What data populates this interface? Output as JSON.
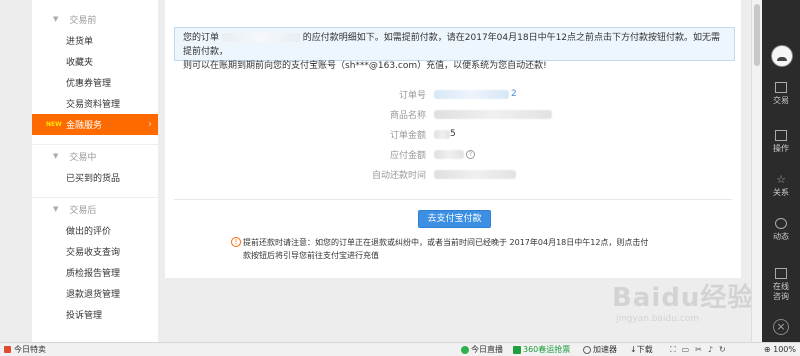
{
  "sidebar": {
    "sections": [
      {
        "title": "交易前",
        "items": [
          "进货单",
          "收藏夹",
          "优惠券管理",
          "交易资料管理"
        ],
        "active_item": "金融服务",
        "active_badge": "NEW"
      },
      {
        "title": "交易中",
        "items": [
          "已买到的货品"
        ]
      },
      {
        "title": "交易后",
        "items": [
          "做出的评价",
          "交易收支查询",
          "质检报告管理",
          "退款退货管理",
          "投诉管理"
        ]
      }
    ]
  },
  "notice": {
    "prefix": "您的订单",
    "suffix_line1": "的应付款明细如下。如需提前付款，请在2017年04月18日中午12点之前点击下方付款按钮付款。如无需提前付款，",
    "line2": "则可以在账期到期前向您的支付宝账号（sh***@163.com）充值，以便系统为您自动还款!"
  },
  "info": {
    "order_no_label": "订单号",
    "order_no_tail": "2",
    "product_label": "商品名称",
    "order_amount_label": "订单金额",
    "order_amount_partial": "5",
    "payable_label": "应付金额",
    "payable_help": "?",
    "auto_repay_label": "自动还款时间"
  },
  "pay_button": "去支付宝付款",
  "warning": {
    "icon": "!",
    "line1": "提前还款时请注意：如您的订单正在退款或纠纷中，或者当前时间已经晚于 2017年04月18日中午12点，则点击付",
    "line2": "款按钮后将引导您前往支付宝进行充值"
  },
  "right_toolbar": {
    "tools": [
      {
        "label": "交易",
        "icon": "cart-icon"
      },
      {
        "label": "操作",
        "icon": "grid-icon"
      },
      {
        "label": "关系",
        "icon": "star-icon"
      },
      {
        "label": "动态",
        "icon": "clock-icon"
      },
      {
        "label_line1": "在线",
        "label_line2": "咨询",
        "icon": "chat-icon"
      }
    ],
    "close": "×"
  },
  "status_bar": {
    "today_deals": "今日特卖",
    "live": "今日直播",
    "tickets": "360春运抢票",
    "accelerator": "加速器",
    "download": "下载",
    "zoom": "100%"
  },
  "watermark": {
    "main": "Baidu经验",
    "sub": "jingyan.baidu.com"
  },
  "colors": {
    "accent": "#ff6a00",
    "button": "#3d8fe3",
    "toolbar": "#2b2b2b",
    "notice_bg": "#edf5fd"
  }
}
